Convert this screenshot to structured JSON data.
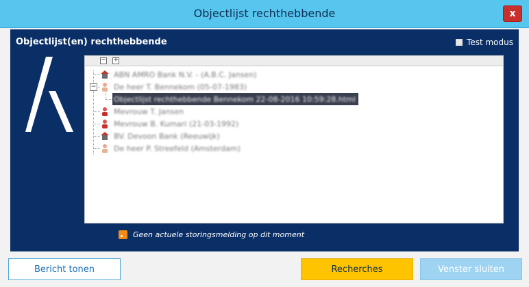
{
  "window": {
    "title": "Objectlijst rechthebbende",
    "close_icon": "close-x",
    "close_label": "x"
  },
  "panel": {
    "header": "Objectlijst(en) rechthebbende",
    "test_mode_label": "Test modus",
    "test_mode_checked": false
  },
  "tree": {
    "collapse_all": "−",
    "expand_all": "+",
    "items": [
      {
        "label": "ABN AMRO Bank N.V. - (A.B.C. Jansen)",
        "icon": "bank-icon",
        "level": 0
      },
      {
        "label": "De heer T. Bennekom (05-07-1983)",
        "icon": "person-icon",
        "level": 0,
        "expanded": true
      },
      {
        "label": "Objectlijst rechthebbende Bennekom 22-08-2016 10:59:28.html",
        "icon": "document",
        "level": 1,
        "selected": true
      },
      {
        "label": "Mevrouw T. Jansen",
        "icon": "person-female-icon",
        "level": 0
      },
      {
        "label": "Mevrouw B. Kumari (21-03-1992)",
        "icon": "person-female-icon",
        "level": 0
      },
      {
        "label": "BV. Devoon Bank (Reeuwijk)",
        "icon": "bank-icon",
        "level": 0
      },
      {
        "label": "De heer P. Streefeld (Amsterdam)",
        "icon": "person-icon",
        "level": 0
      }
    ]
  },
  "status": {
    "icon": "rss-icon",
    "message": "Geen actuele storingsmelding op dit moment"
  },
  "buttons": {
    "bericht": "Bericht tonen",
    "recherches": "Recherches",
    "sluiten": "Venster sluiten"
  },
  "colors": {
    "titlebar": "#56c6ee",
    "panel": "#0a2f67",
    "recherches": "#ffc400",
    "sluiten": "#9ed4f2"
  }
}
